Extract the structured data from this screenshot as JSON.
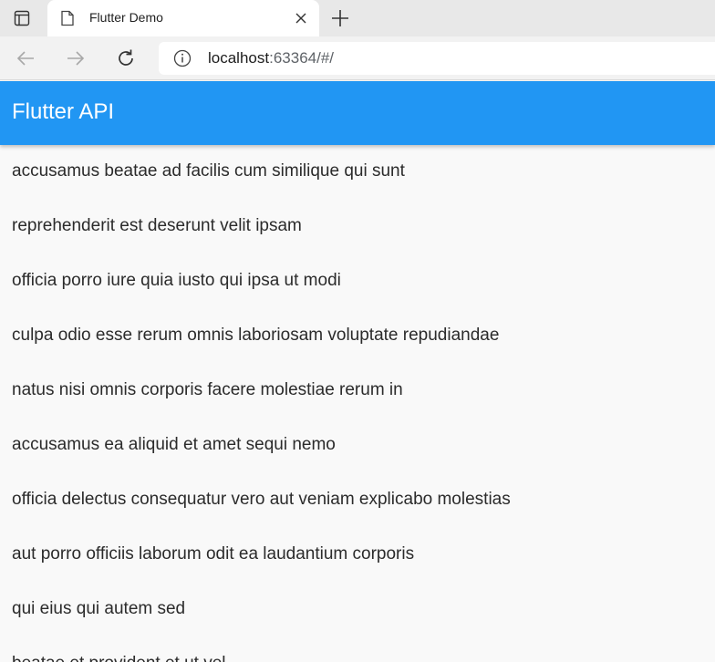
{
  "browser": {
    "tab_title": "Flutter Demo",
    "url_host": "localhost",
    "url_rest": ":63364/#/"
  },
  "app": {
    "title": "Flutter API",
    "primary_color": "#2196f3"
  },
  "posts": [
    "accusamus beatae ad facilis cum similique qui sunt",
    "reprehenderit est deserunt velit ipsam",
    "officia porro iure quia iusto qui ipsa ut modi",
    "culpa odio esse rerum omnis laboriosam voluptate repudiandae",
    "natus nisi omnis corporis facere molestiae rerum in",
    "accusamus ea aliquid et amet sequi nemo",
    "officia delectus consequatur vero aut veniam explicabo molestias",
    "aut porro officiis laborum odit ea laudantium corporis",
    "qui eius qui autem sed",
    "beatae et provident et ut vel"
  ],
  "icons": {
    "tab_actions": "tab-actions-icon",
    "page": "page-icon",
    "close": "close-icon",
    "new_tab": "plus-icon",
    "back": "back-arrow-icon",
    "forward": "forward-arrow-icon",
    "reload": "reload-icon",
    "site_info": "info-icon"
  }
}
